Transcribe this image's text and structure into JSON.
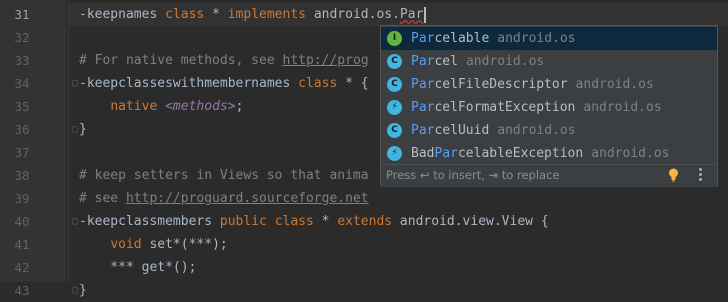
{
  "editor": {
    "line_numbers": [
      "31",
      "32",
      "33",
      "34",
      "35",
      "36",
      "37",
      "38",
      "39",
      "40",
      "41",
      "42",
      "43"
    ],
    "current_line": "31",
    "lines": [
      {
        "segments": [
          {
            "t": "-keepnames ",
            "c": "plain"
          },
          {
            "t": "class",
            "c": "kw"
          },
          {
            "t": " * ",
            "c": "plain"
          },
          {
            "t": "implements",
            "c": "kw"
          },
          {
            "t": " android.os.",
            "c": "plain"
          },
          {
            "t": "Par",
            "c": "err"
          }
        ]
      },
      {
        "segments": []
      },
      {
        "segments": [
          {
            "t": "# For native methods, see ",
            "c": "cm"
          },
          {
            "t": "http://prog",
            "c": "url"
          }
        ]
      },
      {
        "segments": [
          {
            "t": "-keepclasseswithmembernames ",
            "c": "plain"
          },
          {
            "t": "class",
            "c": "kw"
          },
          {
            "t": " * {",
            "c": "plain"
          }
        ]
      },
      {
        "segments": [
          {
            "t": "    ",
            "c": "plain"
          },
          {
            "t": "native",
            "c": "meta"
          },
          {
            "t": " ",
            "c": "plain"
          },
          {
            "t": "<methods>",
            "c": "ital"
          },
          {
            "t": ";",
            "c": "plain"
          }
        ]
      },
      {
        "segments": [
          {
            "t": "}",
            "c": "plain"
          }
        ]
      },
      {
        "segments": []
      },
      {
        "segments": [
          {
            "t": "# keep setters in Views so that anima",
            "c": "cm"
          }
        ]
      },
      {
        "segments": [
          {
            "t": "# see ",
            "c": "cm"
          },
          {
            "t": "http://proguard.sourceforge.net",
            "c": "url"
          }
        ]
      },
      {
        "segments": [
          {
            "t": "-keepclassmembers ",
            "c": "plain"
          },
          {
            "t": "public",
            "c": "kw"
          },
          {
            "t": " ",
            "c": "plain"
          },
          {
            "t": "class",
            "c": "kw"
          },
          {
            "t": " * ",
            "c": "plain"
          },
          {
            "t": "extends",
            "c": "kw"
          },
          {
            "t": " android.view.View {",
            "c": "plain"
          }
        ]
      },
      {
        "segments": [
          {
            "t": "    ",
            "c": "plain"
          },
          {
            "t": "void",
            "c": "kw"
          },
          {
            "t": " set*(***);",
            "c": "plain"
          }
        ]
      },
      {
        "segments": [
          {
            "t": "    *** get*();",
            "c": "plain"
          }
        ]
      },
      {
        "segments": [
          {
            "t": "}",
            "c": "plain"
          }
        ]
      }
    ]
  },
  "completion_popup": {
    "query": "Par",
    "items": [
      {
        "icon": "interface-icon",
        "icon_letter": "I",
        "prefix": "",
        "match": "Par",
        "suffix": "celable",
        "package": "android.os",
        "selected": true
      },
      {
        "icon": "class-icon",
        "icon_letter": "C",
        "prefix": "",
        "match": "Par",
        "suffix": "cel",
        "package": "android.os",
        "selected": false
      },
      {
        "icon": "class-icon",
        "icon_letter": "C",
        "prefix": "",
        "match": "Par",
        "suffix": "celFileDescriptor",
        "package": "android.os",
        "selected": false
      },
      {
        "icon": "exception-class-icon",
        "icon_letter": "⚡",
        "prefix": "",
        "match": "Par",
        "suffix": "celFormatException",
        "package": "android.os",
        "selected": false
      },
      {
        "icon": "class-icon",
        "icon_letter": "C",
        "prefix": "",
        "match": "Par",
        "suffix": "celUuid",
        "package": "android.os",
        "selected": false
      },
      {
        "icon": "exception-class-icon",
        "icon_letter": "⚡",
        "prefix": "Bad",
        "match": "Par",
        "suffix": "celableException",
        "package": "android.os",
        "selected": false
      }
    ],
    "footer_hint": "Press ↩ to insert, ⇥ to replace"
  },
  "colors": {
    "background": "#2b2b2b",
    "keyword": "#cc7832",
    "comment": "#808080",
    "match_highlight": "#589df6",
    "selection": "#0d293e"
  }
}
